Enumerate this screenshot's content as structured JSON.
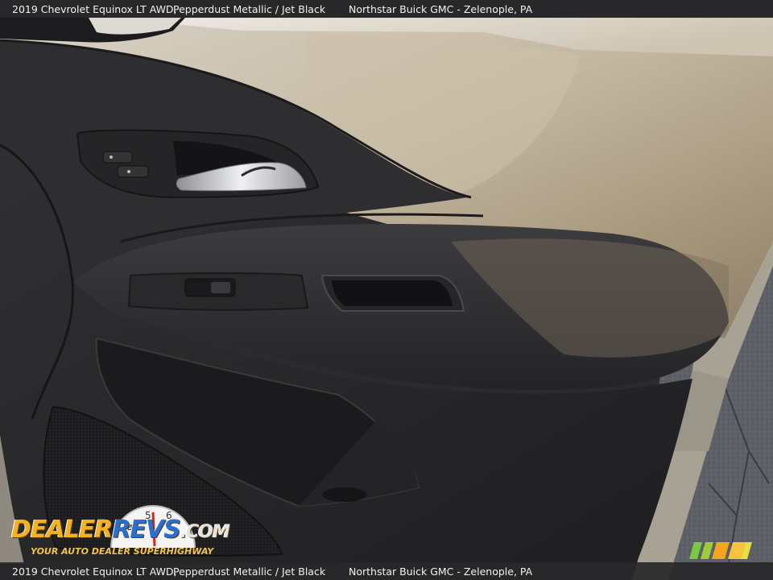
{
  "caption": {
    "vehicle": "2019 Chevrolet Equinox LT AWD,",
    "color": "Pepperdust Metallic / Jet Black",
    "dealer": "Northstar Buick GMC - Zelenople, PA"
  },
  "watermark": {
    "logo_dealer": "DEALER",
    "logo_revs": "REVS",
    "logo_com": ".COM",
    "tagline": "YOUR AUTO DEALER SUPERHIGHWAY"
  },
  "colors": {
    "caption_bg": "#28282a",
    "trim_metallic": "#b5a68e",
    "interior_black": "#2b2b2d",
    "logo_orange": "#f4b21c",
    "logo_blue": "#2a6fd0"
  }
}
